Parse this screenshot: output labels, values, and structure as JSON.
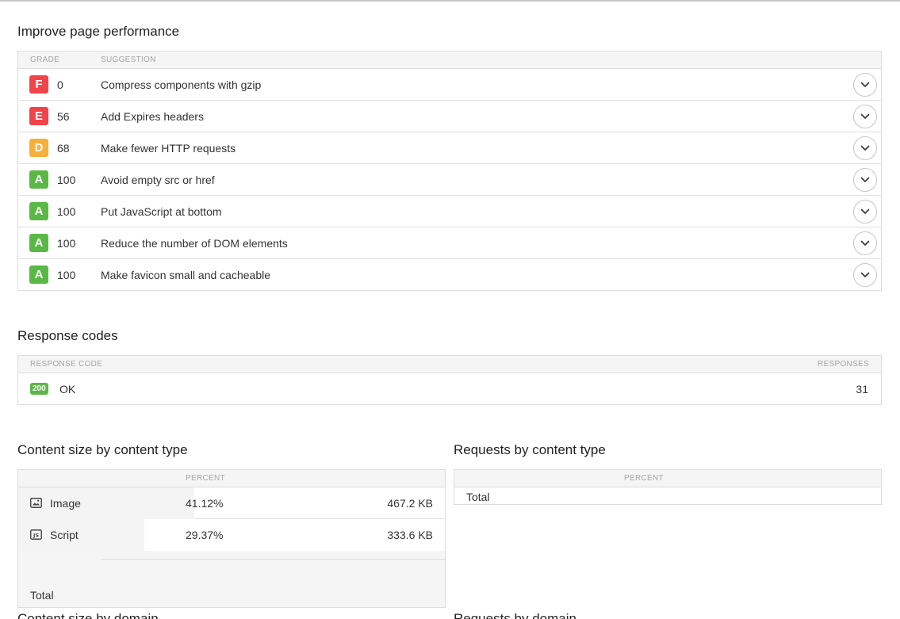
{
  "performance": {
    "title": "Improve page performance",
    "headers": {
      "grade": "GRADE",
      "suggestion": "SUGGESTION"
    },
    "rows": [
      {
        "grade": "F",
        "score": "0",
        "suggestion": "Compress components with gzip",
        "color": "#f0444a"
      },
      {
        "grade": "E",
        "score": "56",
        "suggestion": "Add Expires headers",
        "color": "#f0444a"
      },
      {
        "grade": "D",
        "score": "68",
        "suggestion": "Make fewer HTTP requests",
        "color": "#f7b03a"
      },
      {
        "grade": "A",
        "score": "100",
        "suggestion": "Avoid empty src or href",
        "color": "#5ab845"
      },
      {
        "grade": "A",
        "score": "100",
        "suggestion": "Put JavaScript at bottom",
        "color": "#5ab845"
      },
      {
        "grade": "A",
        "score": "100",
        "suggestion": "Reduce the number of DOM elements",
        "color": "#5ab845"
      },
      {
        "grade": "A",
        "score": "100",
        "suggestion": "Make favicon small and cacheable",
        "color": "#5ab845"
      }
    ]
  },
  "response_codes": {
    "title": "Response codes",
    "headers": {
      "code": "RESPONSE CODE",
      "responses": "RESPONSES"
    },
    "rows": [
      {
        "code": "200",
        "text": "OK",
        "count": "31"
      }
    ]
  },
  "content_size": {
    "title": "Content size by content type",
    "headers": {
      "percent": "PERCENT"
    },
    "rows": [
      {
        "icon": "image-icon",
        "name": "Image",
        "percent": "41.12%",
        "share": 0.4112,
        "size": "467.2 KB"
      },
      {
        "icon": "script-icon",
        "name": "Script",
        "percent": "29.37%",
        "share": 0.2937,
        "size": "333.6 KB"
      }
    ],
    "total_label": "Total"
  },
  "requests_type": {
    "title": "Requests by content type",
    "headers": {
      "percent": "PERCENT"
    },
    "total_label": "Total"
  },
  "footer_titles": {
    "left": "Content size by domain",
    "right": "Requests by domain"
  }
}
